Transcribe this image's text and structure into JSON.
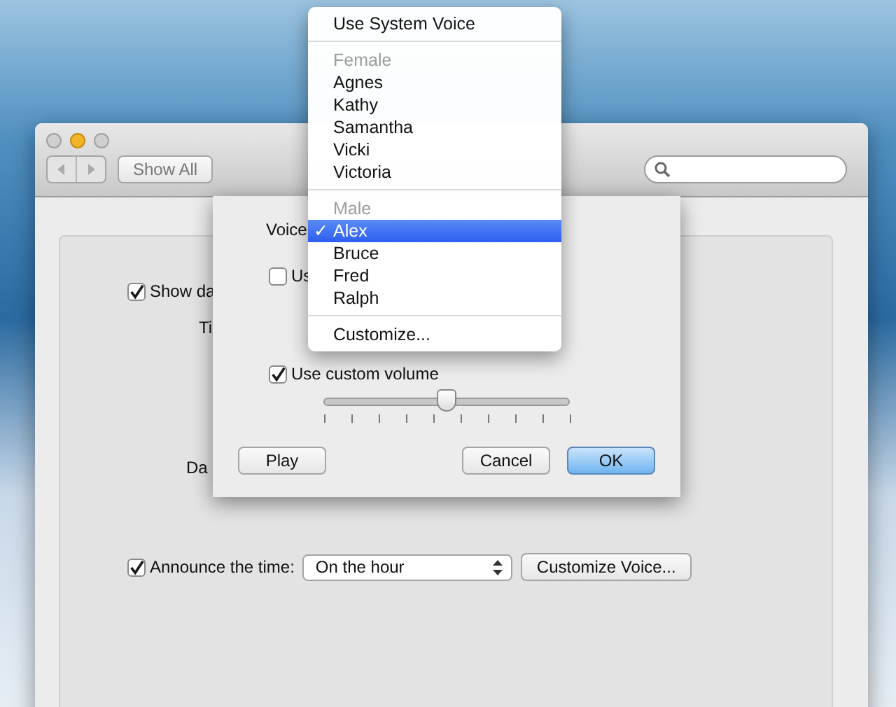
{
  "window": {
    "toolbar": {
      "show_all": "Show All"
    },
    "panel": {
      "show_date_checkbox": {
        "label": "Show da",
        "checked": true
      },
      "time_label": "Ti",
      "date_label": "Da",
      "announce": {
        "label": "Announce the time:",
        "checked": true,
        "interval": "On the hour",
        "customize": "Customize Voice..."
      }
    }
  },
  "sheet": {
    "voice_label": "Voice",
    "rate_checkbox": {
      "label": "Us",
      "checked": false
    },
    "volume_checkbox": {
      "label": "Use custom volume",
      "checked": true
    },
    "volume": {
      "level": 0.5
    },
    "buttons": [
      {
        "label": "Play",
        "kind": "normal"
      },
      {
        "label": "Cancel",
        "kind": "normal"
      },
      {
        "label": "OK",
        "kind": "default"
      }
    ]
  },
  "voice_menu": {
    "items": [
      {
        "kind": "item",
        "label": "Use System Voice",
        "selected": false
      },
      {
        "kind": "separator"
      },
      {
        "kind": "header",
        "label": "Female"
      },
      {
        "kind": "item",
        "label": "Agnes",
        "selected": false
      },
      {
        "kind": "item",
        "label": "Kathy",
        "selected": false
      },
      {
        "kind": "item",
        "label": "Samantha",
        "selected": false
      },
      {
        "kind": "item",
        "label": "Vicki",
        "selected": false
      },
      {
        "kind": "item",
        "label": "Victoria",
        "selected": false
      },
      {
        "kind": "separator"
      },
      {
        "kind": "header",
        "label": "Male"
      },
      {
        "kind": "item",
        "label": "Alex",
        "selected": true,
        "check": "✓"
      },
      {
        "kind": "item",
        "label": "Bruce",
        "selected": false
      },
      {
        "kind": "item",
        "label": "Fred",
        "selected": false
      },
      {
        "kind": "item",
        "label": "Ralph",
        "selected": false
      },
      {
        "kind": "separator"
      },
      {
        "kind": "item",
        "label": "Customize...",
        "selected": false
      }
    ]
  }
}
